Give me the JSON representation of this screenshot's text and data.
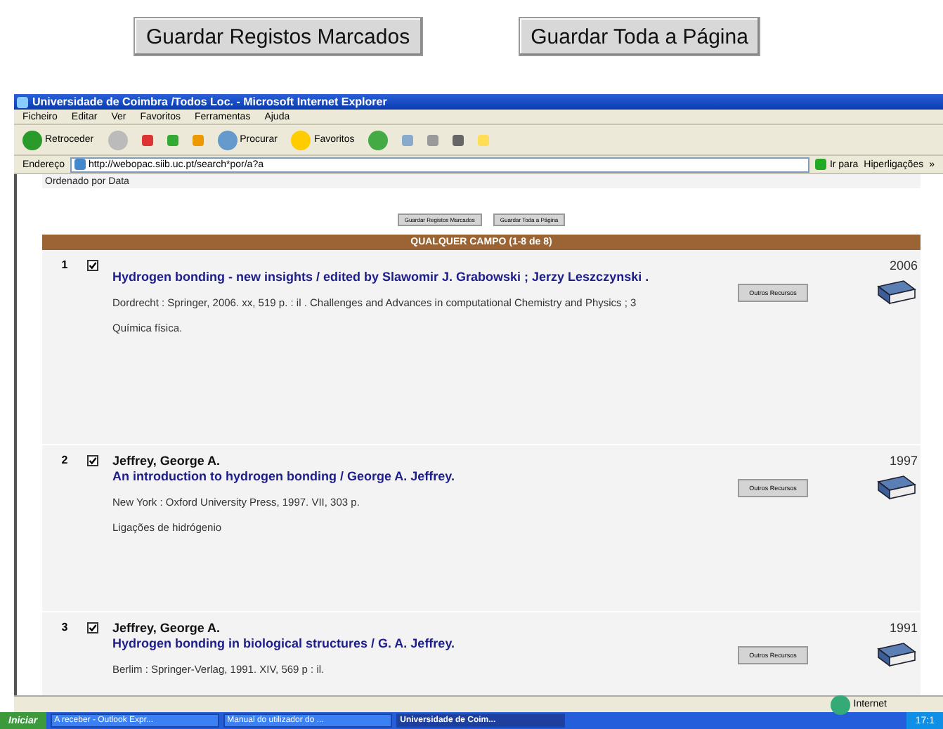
{
  "top_buttons": [
    "Guardar Registos Marcados",
    "Guardar Toda a Página"
  ],
  "window": {
    "title": "Universidade de Coimbra /Todos Loc. - Microsoft Internet Explorer"
  },
  "menu": [
    "Ficheiro",
    "Editar",
    "Ver",
    "Favoritos",
    "Ferramentas",
    "Ajuda"
  ],
  "toolbar": {
    "back": "Retroceder",
    "search": "Procurar",
    "favorites": "Favoritos"
  },
  "address": {
    "label": "Endereço",
    "value": "http://webopac.siib.uc.pt/search*por/a?a",
    "go": "Ir para",
    "links": "Hiperligações",
    "chevron": "»"
  },
  "page": {
    "sort_note": "Ordenado por Data",
    "buttons": [
      "Guardar Registos Marcados",
      "Guardar Toda a Página"
    ],
    "header": "QUALQUER CAMPO (1-8 de 8)",
    "results": [
      {
        "number": "1",
        "checked": true,
        "title": "Hydrogen bonding - new insights / edited by Slawomir J. Grabowski ; Jerzy Leszczynski .",
        "imprint": "Dordrecht : Springer, 2006.  xx, 519 p. : il .  Challenges and Advances in computational Chemistry and Physics ; 3",
        "subject": "Química física.",
        "year": "2006",
        "button": "Outros Recursos"
      },
      {
        "number": "2",
        "checked": true,
        "author": "Jeffrey, George A.",
        "title": "An introduction to hydrogen bonding / George A. Jeffrey.",
        "imprint": "New York : Oxford University Press, 1997.  VII, 303 p.",
        "subject": "Ligações de hidrógenio",
        "year": "1997",
        "button": "Outros Recursos"
      },
      {
        "number": "3",
        "checked": true,
        "author": "Jeffrey, George A.",
        "title": "Hydrogen bonding in biological structures / G. A. Jeffrey.",
        "imprint": "Berlim : Springer-Verlag, 1991.  XIV, 569 p : il.",
        "year": "1991",
        "button": "Outros Recursos"
      }
    ]
  },
  "status_bar": {
    "zone": "Internet"
  },
  "taskbar": {
    "start": "Iniciar",
    "tasks": [
      {
        "label": "A receber - Outlook Expr...",
        "selected": false
      },
      {
        "label": "Manual do utilizador do ...",
        "selected": false
      },
      {
        "label": "Universidade de Coim...",
        "selected": true
      }
    ],
    "clock": "17:1"
  }
}
